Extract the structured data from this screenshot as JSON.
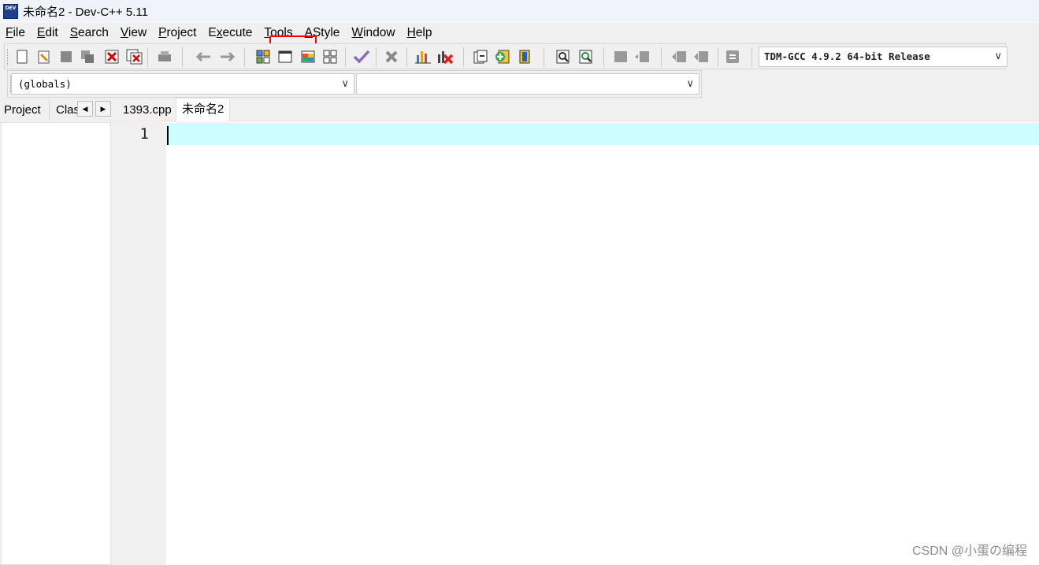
{
  "window": {
    "title": "未命名2 - Dev-C++ 5.11",
    "icon_text": "DEV"
  },
  "menu": [
    {
      "label": "File",
      "accel": "F",
      "rest": "ile"
    },
    {
      "label": "Edit",
      "accel": "E",
      "rest": "dit"
    },
    {
      "label": "Search",
      "accel": "S",
      "rest": "earch"
    },
    {
      "label": "View",
      "accel": "V",
      "rest": "iew"
    },
    {
      "label": "Project",
      "accel": "P",
      "rest": "roject"
    },
    {
      "label": "Execute",
      "accel": "x",
      "pre": "E",
      "rest": "ecute"
    },
    {
      "label": "Tools",
      "accel": "T",
      "rest": "ools"
    },
    {
      "label": "AStyle",
      "accel": "A",
      "rest": "Style"
    },
    {
      "label": "Window",
      "accel": "W",
      "rest": "indow"
    },
    {
      "label": "Help",
      "accel": "H",
      "rest": "elp"
    }
  ],
  "toolbar": {
    "compiler": "TDM-GCC 4.9.2 64-bit Release",
    "globals_combo": "(globals)",
    "function_combo": ""
  },
  "left_panel": {
    "tabs": [
      "Project",
      "Clas"
    ]
  },
  "editor": {
    "tabs": [
      {
        "label": "1393.cpp",
        "active": false
      },
      {
        "label": "未命名2",
        "active": true
      }
    ],
    "line_number": "1"
  },
  "watermark": "CSDN @小蛋の编程",
  "colors": {
    "current_line": "#ccfdff",
    "highlight": "#ff0000"
  }
}
